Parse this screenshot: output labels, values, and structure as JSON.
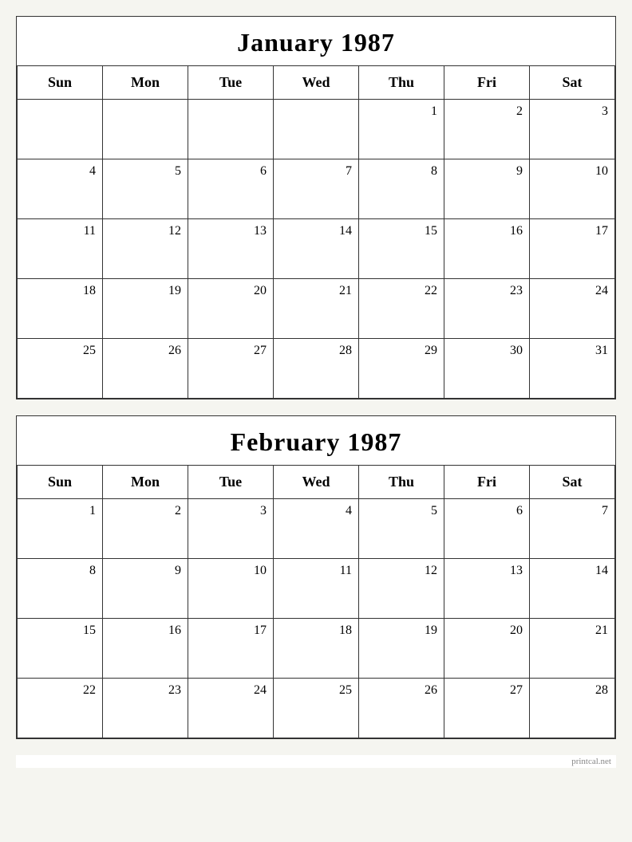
{
  "calendars": [
    {
      "id": "january-1987",
      "title": "January 1987",
      "headers": [
        "Sun",
        "Mon",
        "Tue",
        "Wed",
        "Thu",
        "Fri",
        "Sat"
      ],
      "weeks": [
        [
          null,
          null,
          null,
          null,
          1,
          2,
          3
        ],
        [
          4,
          5,
          6,
          7,
          8,
          9,
          10
        ],
        [
          11,
          12,
          13,
          14,
          15,
          16,
          17
        ],
        [
          18,
          19,
          20,
          21,
          22,
          23,
          24
        ],
        [
          25,
          26,
          27,
          28,
          29,
          30,
          31
        ]
      ]
    },
    {
      "id": "february-1987",
      "title": "February 1987",
      "headers": [
        "Sun",
        "Mon",
        "Tue",
        "Wed",
        "Thu",
        "Fri",
        "Sat"
      ],
      "weeks": [
        [
          1,
          2,
          3,
          4,
          5,
          6,
          7
        ],
        [
          8,
          9,
          10,
          11,
          12,
          13,
          14
        ],
        [
          15,
          16,
          17,
          18,
          19,
          20,
          21
        ],
        [
          22,
          23,
          24,
          25,
          26,
          27,
          28
        ]
      ]
    }
  ],
  "watermark": "printcal.net"
}
